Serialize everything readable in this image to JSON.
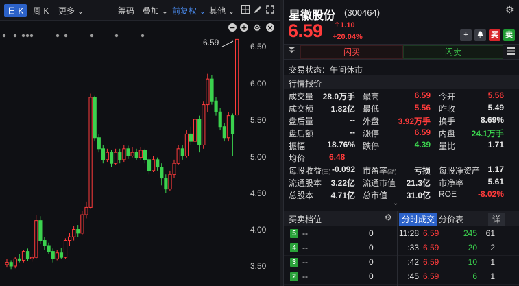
{
  "toolbar": {
    "day_k": "日 K",
    "week_k": "周 K",
    "more": "更多",
    "chips": "筹码",
    "overlay": "叠加",
    "adjust": "前复权",
    "other": "其他"
  },
  "chart": {
    "axis_labels": [
      "6.50",
      "6.00",
      "5.50",
      "5.00",
      "4.50",
      "4.00",
      "3.50"
    ],
    "high_marker": "6.59",
    "up_color": "#ff3b3b",
    "down_color": "#3bd24e"
  },
  "stock": {
    "name": "星徽股份",
    "code": "(300464)",
    "price": "6.59",
    "change": "1.10",
    "change_pct": "+20.04%"
  },
  "actions": {
    "buy_short": "买",
    "sell_short": "卖",
    "flash_buy": "闪买",
    "flash_sell": "闪卖"
  },
  "trade_status": "交易状态：午间休市",
  "quote": {
    "title": "行情报价",
    "rows": [
      [
        {
          "l": "成交量",
          "v": "28.0万手",
          "c": "white"
        },
        {
          "l": "最高",
          "v": "6.59",
          "c": "red"
        },
        {
          "l": "今开",
          "v": "5.56",
          "c": "red"
        }
      ],
      [
        {
          "l": "成交额",
          "v": "1.82亿",
          "c": "white"
        },
        {
          "l": "最低",
          "v": "5.56",
          "c": "red"
        },
        {
          "l": "昨收",
          "v": "5.49",
          "c": "white"
        }
      ],
      [
        {
          "l": "盘后量",
          "v": "--",
          "c": "white"
        },
        {
          "l": "外盘",
          "v": "3.92万手",
          "c": "red"
        },
        {
          "l": "换手",
          "v": "8.69%",
          "c": "white"
        }
      ],
      [
        {
          "l": "盘后额",
          "v": "--",
          "c": "white"
        },
        {
          "l": "涨停",
          "v": "6.59",
          "c": "red"
        },
        {
          "l": "内盘",
          "v": "24.1万手",
          "c": "green"
        }
      ],
      [
        {
          "l": "振幅",
          "v": "18.76%",
          "c": "white"
        },
        {
          "l": "跌停",
          "v": "4.39",
          "c": "green"
        },
        {
          "l": "量比",
          "v": "1.71",
          "c": "white"
        }
      ],
      [
        {
          "l": "均价",
          "v": "6.48",
          "c": "red"
        }
      ],
      [
        {
          "l": "每股收益",
          "v": "-0.092",
          "c": "white",
          "note": "(三)"
        },
        {
          "l": "市盈率",
          "v": "亏损",
          "c": "white",
          "note": "(动)"
        },
        {
          "l": "每股净资产",
          "v": "1.17",
          "c": "white"
        }
      ],
      [
        {
          "l": "流通股本",
          "v": "3.22亿",
          "c": "white"
        },
        {
          "l": "流通市值",
          "v": "21.3亿",
          "c": "white"
        },
        {
          "l": "市净率",
          "v": "5.61",
          "c": "white"
        }
      ],
      [
        {
          "l": "总股本",
          "v": "4.71亿",
          "c": "white"
        },
        {
          "l": "总市值",
          "v": "31.0亿",
          "c": "white"
        },
        {
          "l": "ROE",
          "v": "-8.02%",
          "c": "red"
        }
      ]
    ]
  },
  "order_book": {
    "title": "买卖档位",
    "levels": [
      {
        "n": "5",
        "price": "--",
        "vol": "0"
      },
      {
        "n": "4",
        "price": "--",
        "vol": "0"
      },
      {
        "n": "3",
        "price": "--",
        "vol": "0"
      },
      {
        "n": "2",
        "price": "--",
        "vol": "0"
      }
    ]
  },
  "ticks": {
    "tab_time": "分时成交",
    "tab_price": "分价表",
    "detail": "详",
    "rows": [
      {
        "t": "11:28",
        "p": "6.59",
        "v": "245",
        "n": "61"
      },
      {
        "t": ":33",
        "p": "6.59",
        "v": "20",
        "n": "2"
      },
      {
        "t": ":42",
        "p": "6.59",
        "v": "10",
        "n": "1"
      },
      {
        "t": ":45",
        "p": "6.59",
        "v": "6",
        "n": "1"
      }
    ]
  }
}
